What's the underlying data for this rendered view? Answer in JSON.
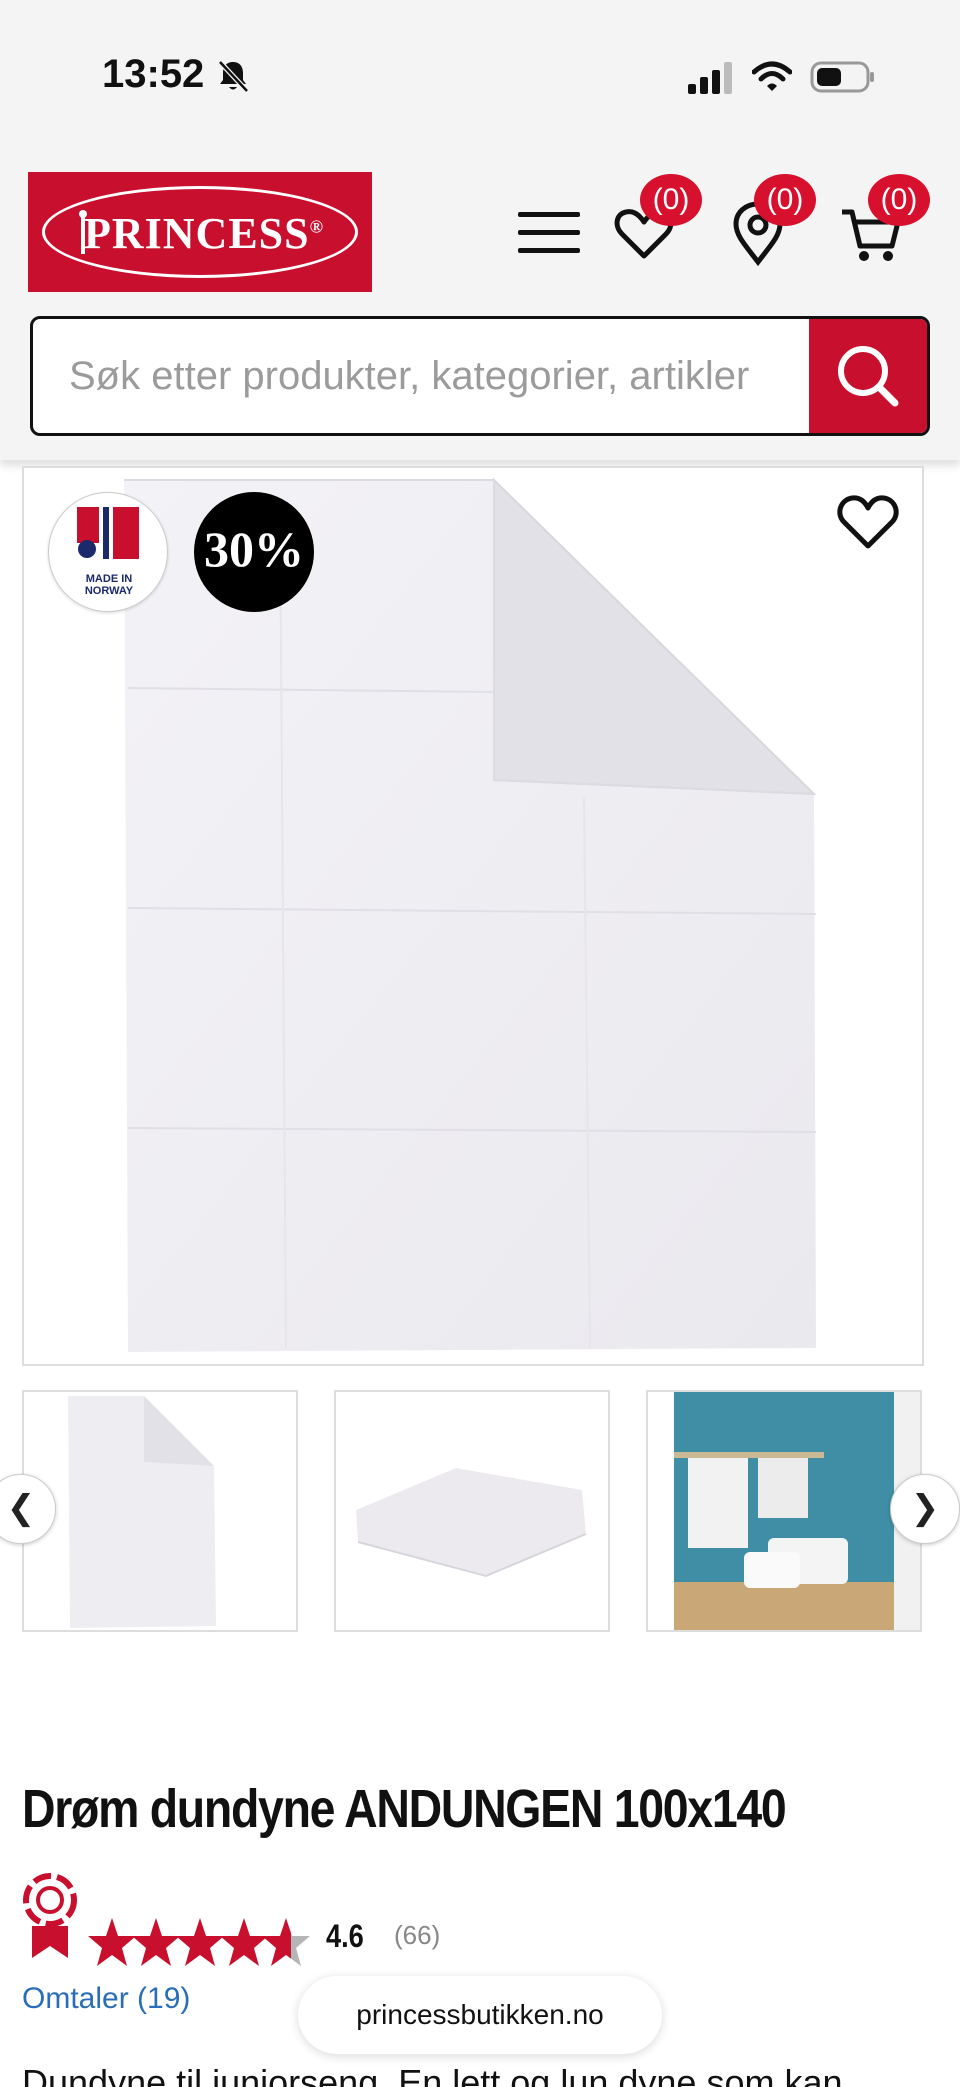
{
  "status_bar": {
    "time": "13:52"
  },
  "header": {
    "logo_text": "PRINCESS",
    "logo_registered": "®",
    "wishlist_count": "(0)",
    "stores_count": "(0)",
    "cart_count": "(0)"
  },
  "search": {
    "placeholder": "Søk etter produkter, kategorier, artikler"
  },
  "gallery": {
    "made_in_label": "MADE IN",
    "made_in_country": "NORWAY",
    "discount": "30%",
    "prev_arrow": "❮",
    "next_arrow": "❯"
  },
  "product": {
    "title": "Drøm dundyne ANDUNGEN 100x140",
    "rating_value": "4.6",
    "rating_count": "(66)",
    "reviews_link": "Omtaler (19)",
    "description": "Dundyne til juniorseng. En lett og lun dyne som kan"
  },
  "browser": {
    "url": "princessbutikken.no"
  },
  "colors": {
    "brand_red": "#c8102e",
    "badge_red": "#d7102e",
    "link_blue": "#2a6db8"
  }
}
